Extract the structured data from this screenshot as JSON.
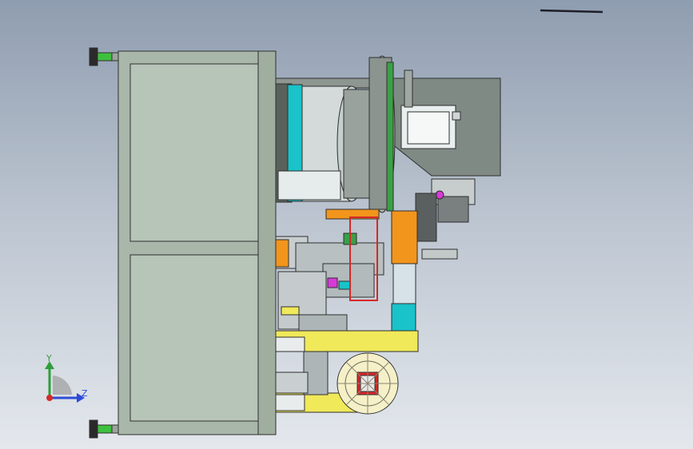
{
  "viewport": {
    "background_top": "#8f9db0",
    "background_bottom": "#e4e8ed"
  },
  "triad": {
    "y_label": "Y",
    "z_label": "Z",
    "y_color": "#2e9e3a",
    "z_color": "#2f4bd6",
    "x_color": "#d62a2a"
  },
  "model": {
    "frame_color": "#a9b7aa",
    "frame_edge": "#3a3a3a",
    "housing_color": "#7f8a84",
    "drum_color": "#cfd6d6",
    "accent_cyan": "#19c3c9",
    "accent_orange": "#f2951c",
    "accent_yellow": "#f0e95a",
    "accent_green": "#3aa046",
    "accent_magenta": "#d83ad8",
    "accent_red": "#d62828"
  }
}
